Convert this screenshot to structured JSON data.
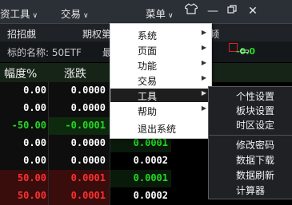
{
  "menubar": {
    "items": [
      {
        "label": "资工具",
        "has_chevron": true
      },
      {
        "label": "交易",
        "has_chevron": true
      },
      {
        "label": "菜单",
        "has_chevron": true
      }
    ],
    "icons": [
      "shirt-icon",
      "minimize-icon",
      "restore-icon",
      "close-icon"
    ]
  },
  "header2": {
    "items": [
      "招招覷",
      "期权第",
      "频"
    ]
  },
  "info": {
    "label": "标的名称: 50ETF",
    "label2": "最",
    "green_value": "-0.0"
  },
  "columns": {
    "col1": "幅度%",
    "col2": "涨跌"
  },
  "colors": {
    "white_value": "#ffffff",
    "green_value": "#22d822",
    "red_value": "#ff3030",
    "highlight_bg": "#1e1e1e"
  },
  "rows": [
    {
      "c1": "0.00",
      "c2": "0.0000",
      "c3": "",
      "c1_color": "#ffffff",
      "c2_color": "#ffffff",
      "c3_color": "#22d822"
    },
    {
      "c1": "0.00",
      "c2": "0.0000",
      "c3": "",
      "c1_color": "#ffffff",
      "c2_color": "#ffffff",
      "c3_color": "#22d822"
    },
    {
      "c1": "-50.00",
      "c2": "-0.0001",
      "c3": "",
      "c1_color": "#22d822",
      "c2_color": "#22d822",
      "c3_color": "#22d822"
    },
    {
      "c1": "0.00",
      "c2": "0.0000",
      "c3": "0.0001",
      "c1_color": "#ffffff",
      "c2_color": "#ffffff",
      "c3_color": "#22d822"
    },
    {
      "c1": "0.00",
      "c2": "0.0000",
      "c3": "0.0002",
      "c1_color": "#ffffff",
      "c2_color": "#ffffff",
      "c3_color": "#ffffff"
    },
    {
      "c1": "50.00",
      "c2": "0.0001",
      "c3": "0.0001",
      "c1_color": "#ff3030",
      "c2_color": "#ff3030",
      "c3_color": "#22d822"
    },
    {
      "c1": "50.00",
      "c2": "0.0001",
      "c3": "0.0002",
      "c1_color": "#ff3030",
      "c2_color": "#ff3030",
      "c3_color": "#ffffff"
    }
  ],
  "popup_menu": {
    "items": [
      {
        "label": "系统",
        "arrow": true
      },
      {
        "label": "页面",
        "arrow": true
      },
      {
        "label": "功能",
        "arrow": true
      },
      {
        "label": "交易",
        "arrow": true
      },
      {
        "label": "工具",
        "arrow": true,
        "highlighted": true
      },
      {
        "label": "帮助",
        "arrow": true
      },
      {
        "label": "退出系统",
        "arrow": false
      }
    ]
  },
  "submenu": {
    "items": [
      "个性设置",
      "板块设置",
      "时区设定",
      "修改密码",
      "数据下载",
      "数据刷新",
      "计算器"
    ]
  }
}
